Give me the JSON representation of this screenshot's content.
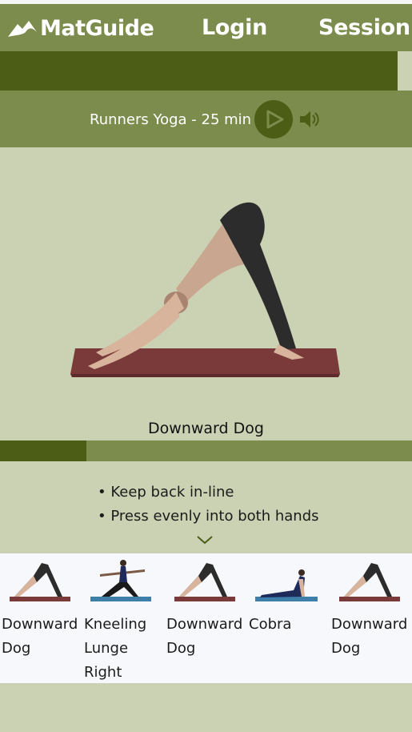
{
  "nav": {
    "brand": "MatGuide",
    "login": "Login",
    "session": "Session"
  },
  "session_progress": 0.965,
  "session": {
    "title": "Runners Yoga - 25 min"
  },
  "current_pose": {
    "name": "Downward Dog",
    "timer_progress": 0.21,
    "tips": [
      "Keep back in-line",
      "Press evenly into both hands"
    ]
  },
  "carousel": [
    {
      "label": "Downward Dog",
      "icon": "downward-dog"
    },
    {
      "label": "Kneeling Lunge Right",
      "icon": "kneeling-lunge"
    },
    {
      "label": "Downward Dog",
      "icon": "downward-dog"
    },
    {
      "label": "Cobra",
      "icon": "cobra"
    },
    {
      "label": "Downward Dog",
      "icon": "downward-dog"
    }
  ],
  "colors": {
    "nav": "#7c8c4d",
    "dark_green": "#4c5e16",
    "background": "#cbd2b3",
    "carousel_bg": "#f7f8fb"
  }
}
